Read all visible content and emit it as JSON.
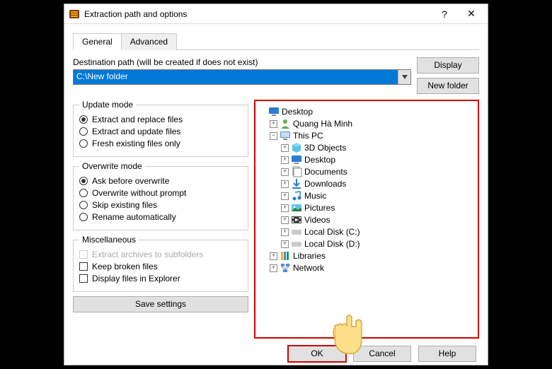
{
  "window": {
    "title": "Extraction path and options"
  },
  "tabs": {
    "general": "General",
    "advanced": "Advanced"
  },
  "path": {
    "label": "Destination path (will be created if does not exist)",
    "value": "C:\\New folder"
  },
  "side": {
    "display": "Display",
    "newfolder": "New folder"
  },
  "update": {
    "legend": "Update mode",
    "extract_replace": "Extract and replace files",
    "extract_update": "Extract and update files",
    "fresh": "Fresh existing files only"
  },
  "overwrite": {
    "legend": "Overwrite mode",
    "ask": "Ask before overwrite",
    "without": "Overwrite without prompt",
    "skip": "Skip existing files",
    "rename": "Rename automatically"
  },
  "misc": {
    "legend": "Miscellaneous",
    "subfolders": "Extract archives to subfolders",
    "keep": "Keep broken files",
    "explorer": "Display files in Explorer"
  },
  "save": "Save settings",
  "tree": {
    "desktop": "Desktop",
    "user": "Quang Hà Minh",
    "thispc": "This PC",
    "objects3d": "3D Objects",
    "desktop2": "Desktop",
    "documents": "Documents",
    "downloads": "Downloads",
    "music": "Music",
    "pictures": "Pictures",
    "videos": "Videos",
    "diskC": "Local Disk (C:)",
    "diskD": "Local Disk (D:)",
    "libraries": "Libraries",
    "network": "Network"
  },
  "footer": {
    "ok": "OK",
    "cancel": "Cancel",
    "help": "Help"
  }
}
